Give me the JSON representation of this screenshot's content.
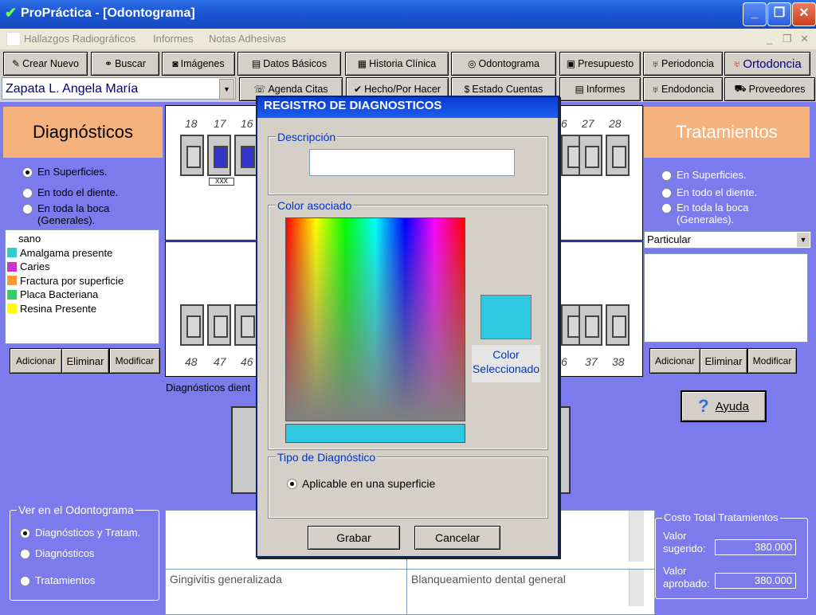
{
  "window": {
    "title": "ProPráctica - [Odontograma]",
    "controls": {
      "minimize": "_",
      "maximize": "❐",
      "close": "✕"
    }
  },
  "menu": {
    "items": [
      "Hallazgos Radiográficos",
      "Informes",
      "Notas Adhesivas"
    ],
    "right": {
      "minimize": "_",
      "restore": "❐",
      "close": "✕"
    }
  },
  "toolbar": {
    "row1": [
      {
        "label": "Crear Nuevo",
        "icon": "person-icon"
      },
      {
        "label": "Buscar",
        "icon": "binoculars-icon"
      },
      {
        "label": "Imágenes",
        "icon": "camera-icon"
      },
      {
        "label": "Datos Básicos",
        "icon": "card-icon"
      },
      {
        "label": "Historia Clínica",
        "icon": "printer-icon"
      },
      {
        "label": "Odontograma",
        "icon": "chart-icon"
      },
      {
        "label": "Presupuesto",
        "icon": "register-icon"
      },
      {
        "label": "Periodoncia",
        "icon": "tooth-icon"
      },
      {
        "label": "Ortodoncia",
        "icon": "braces-icon"
      }
    ],
    "row2": [
      {
        "label": "Agenda Citas",
        "icon": "phone-icon"
      },
      {
        "label": "Hecho/Por Hacer",
        "icon": "check-icon"
      },
      {
        "label": "Estado Cuentas",
        "icon": "dollar-icon"
      },
      {
        "label": "Informes",
        "icon": "report-icon"
      },
      {
        "label": "Endodoncia",
        "icon": "tooth-icon"
      },
      {
        "label": "Proveedores",
        "icon": "truck-icon"
      }
    ],
    "patient": "Zapata L. Angela María"
  },
  "diagnosticos": {
    "title": "Diagnósticos",
    "radios": [
      {
        "label": "En Superficies.",
        "checked": true
      },
      {
        "label": "En todo el diente.",
        "checked": false
      },
      {
        "label": "En toda la boca (Generales).",
        "checked": false
      }
    ],
    "list": [
      {
        "label": "sano",
        "color": ""
      },
      {
        "label": "Amalgama presente",
        "color": "#33cccc"
      },
      {
        "label": "Caries",
        "color": "#cc33cc"
      },
      {
        "label": "Fractura por superficie",
        "color": "#ff9933"
      },
      {
        "label": "Placa Bacteriana",
        "color": "#33cc66"
      },
      {
        "label": "Resina Presente",
        "color": "#ffff00"
      }
    ],
    "buttons": {
      "add": "Adicionar",
      "delete": "Eliminar",
      "edit": "Modificar"
    },
    "dental_label": "Diagnósticos dient"
  },
  "tratamientos": {
    "title": "Tratamientos",
    "radios": [
      {
        "label": "En Superficies.",
        "checked": false
      },
      {
        "label": "En todo el diente.",
        "checked": false
      },
      {
        "label": "En toda la boca (Generales).",
        "checked": false
      }
    ],
    "select_value": "Particular",
    "buttons": {
      "add": "Adicionar",
      "delete": "Eliminar",
      "edit": "Modificar"
    }
  },
  "odontograma": {
    "upper_left_numbers": [
      "18",
      "17",
      "16"
    ],
    "upper_right_numbers": [
      "6",
      "27",
      "28"
    ],
    "lower_left_numbers": [
      "48",
      "47",
      "46"
    ],
    "lower_right_numbers": [
      "6",
      "37",
      "38"
    ]
  },
  "ayuda": {
    "icon": "?",
    "label": "Ayuda"
  },
  "ver": {
    "title": "Ver en el Odontograma",
    "radios": [
      {
        "label": "Diagnósticos y Tratam.",
        "checked": true
      },
      {
        "label": "Diagnósticos",
        "checked": false
      },
      {
        "label": "Tratamientos",
        "checked": false
      }
    ]
  },
  "bottom_fields": {
    "left": "Gingivitis generalizada",
    "right": "Blanqueamiento dental general"
  },
  "costo": {
    "title": "Costo Total Tratamientos",
    "sugerido_label": "Valor sugerido:",
    "sugerido_value": "380.000",
    "aprobado_label": "Valor aprobado:",
    "aprobado_value": "380.000"
  },
  "dialog": {
    "title": "REGISTRO DE DIAGNOSTICOS",
    "descripcion_label": "Descripción",
    "descripcion_value": "",
    "color_label": "Color asociado",
    "selected_color": "#2ec8e0",
    "color_caption": "Color Seleccionado",
    "tipo_label": "Tipo de Diagnóstico",
    "tipo_option": "Aplicable en una superficie",
    "save": "Grabar",
    "cancel": "Cancelar"
  },
  "colors": {
    "background": "#7b7bee",
    "panel_head": "#f5b27c",
    "dialog_title": "#0a3cd0",
    "label_blue": "#0033cc"
  }
}
